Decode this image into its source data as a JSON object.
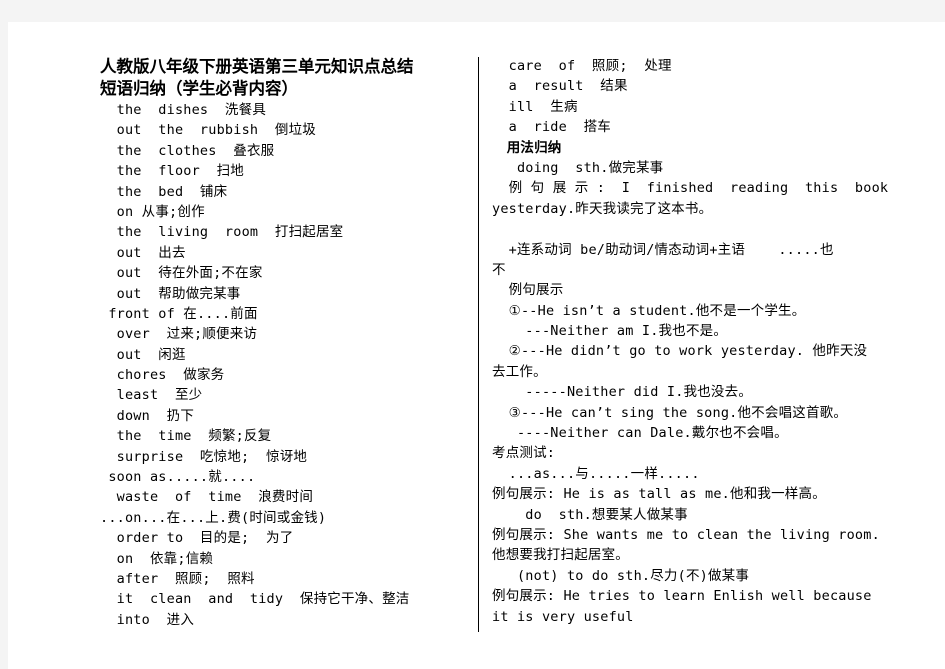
{
  "document": {
    "title": "人教版八年级下册英语第三单元知识点总结",
    "subtitle": "短语归纳（学生必背内容）",
    "left_phrases": [
      "  the  dishes  洗餐具",
      "  out  the  rubbish  倒垃圾",
      "  the  clothes  叠衣服",
      "  the  floor  扫地",
      "  the  bed  铺床",
      "  on 从事;创作",
      "  the  living  room  打扫起居室",
      "  out  出去",
      "  out  待在外面;不在家",
      "  out  帮助做完某事",
      " front of 在....前面",
      "  over  过来;顺便来访",
      "  out  闲逛",
      "  chores  做家务",
      "  least  至少",
      "  down  扔下",
      "  the  time  频繁;反复",
      "  surprise  吃惊地;  惊讶地",
      " soon as.....就....",
      "  waste  of  time  浪费时间",
      "...on...在...上.费(时间或金钱)",
      "  order to  目的是;  为了",
      "  on  依靠;信赖",
      "  after  照顾;  照料",
      "  it  clean  and  tidy  保持它干净、整洁",
      "  into  进入"
    ],
    "right_phrases": [
      "  care  of  照顾;  处理",
      "  a  result  结果",
      "  ill  生病",
      "  a  ride  搭车"
    ],
    "usage_heading": "   用法归纳",
    "usage_1": {
      "pattern": "   doing  sth.做完某事",
      "example_line1": "  例 句 展 示 :  I  finished  reading  this  book",
      "example_line2": "yesterday.昨天我读完了这本书。"
    },
    "usage_2": {
      "pattern_line1": "  +连系动词 be/助动词/情态动词+主语    .....也",
      "pattern_line2": "不",
      "example_heading": "  例句展示",
      "examples": [
        "  ①--He isn’t a student.他不是一个学生。",
        "    ---Neither am I.我也不是。",
        "  ②---He didn’t go to work yesterday. 他昨天没",
        "去工作。",
        "    -----Neither did I.我也没去。",
        "  ③---He can’t sing the song.他不会唱这首歌。",
        "   ----Neither can Dale.戴尔也不会唱。"
      ]
    },
    "test_points": {
      "heading": "考点测试:",
      "items": [
        "  ...as...与.....一样.....",
        "例句展示: He is as tall as me.他和我一样高。",
        "    do  sth.想要某人做某事",
        "例句展示: She wants me to clean the living room.",
        "他想要我打扫起居室。",
        "   (not) to do sth.尽力(不)做某事",
        "例句展示: He tries to learn Enlish well because",
        "it is very useful"
      ]
    }
  }
}
